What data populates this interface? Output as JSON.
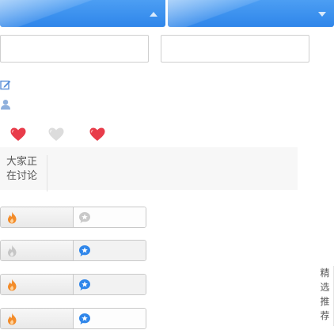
{
  "dropdowns": [
    {
      "name": "dropdown-left",
      "icon": "triangle-up-icon"
    },
    {
      "name": "dropdown-right",
      "icon": "triangle-down-icon"
    }
  ],
  "inputs": [
    {
      "value": "",
      "placeholder": ""
    },
    {
      "value": "",
      "placeholder": ""
    }
  ],
  "icons": {
    "edit": "edit-icon",
    "user": "user-icon"
  },
  "hearts": [
    "heart-red",
    "heart-gray",
    "heart-red"
  ],
  "discuss": {
    "label_line1": "大家正",
    "label_line2": "在讨论"
  },
  "pills": [
    {
      "fire_active": true,
      "star_active": false
    },
    {
      "fire_active": false,
      "star_active": true
    },
    {
      "fire_active": true,
      "star_active": true
    },
    {
      "fire_active": true,
      "star_active": true
    }
  ],
  "featured": {
    "chars": [
      "精",
      "选",
      "推",
      "荐"
    ]
  },
  "colors": {
    "accent_blue": "#3a8ff0",
    "heart_red": "#e83c4a",
    "heart_gray": "#d9d9d9",
    "fire_orange": "#f38c2a",
    "star_blue": "#2f86ea"
  }
}
